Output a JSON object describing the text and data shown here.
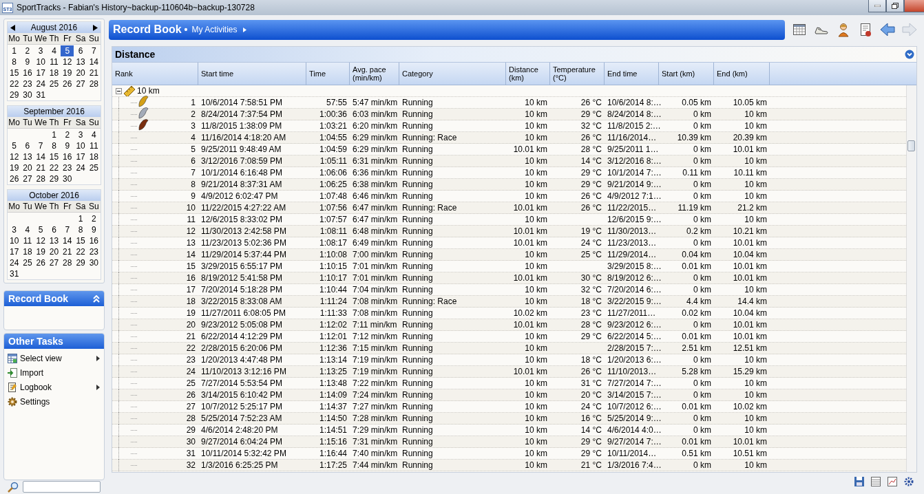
{
  "window": {
    "title": "SportTracks - Fabian's History~backup-110604b~backup-130728",
    "app_icon_text": "ST3"
  },
  "calendars": [
    {
      "title": "August 2016",
      "navigation": true,
      "weekdays": [
        "Mo",
        "Tu",
        "We",
        "Th",
        "Fr",
        "Sa",
        "Su"
      ],
      "weeks": [
        {
          "kind": "full",
          "days": [
            {
              "day": "1",
              "selected": false
            },
            {
              "day": "2",
              "selected": false
            },
            {
              "day": "3",
              "selected": false
            },
            {
              "day": "4",
              "selected": false
            },
            {
              "day": "5",
              "selected": true
            },
            {
              "day": "6",
              "selected": false
            },
            {
              "day": "7",
              "selected": false
            }
          ]
        },
        {
          "kind": "full",
          "days": [
            {
              "day": "8",
              "selected": false
            },
            {
              "day": "9",
              "selected": false
            },
            {
              "day": "10",
              "selected": false
            },
            {
              "day": "11",
              "selected": false
            },
            {
              "day": "12",
              "selected": false
            },
            {
              "day": "13",
              "selected": false
            },
            {
              "day": "14",
              "selected": false
            }
          ]
        },
        {
          "kind": "full",
          "days": [
            {
              "day": "15",
              "selected": false
            },
            {
              "day": "16",
              "selected": false
            },
            {
              "day": "17",
              "selected": false
            },
            {
              "day": "18",
              "selected": false
            },
            {
              "day": "19",
              "selected": false
            },
            {
              "day": "20",
              "selected": false
            },
            {
              "day": "21",
              "selected": false
            }
          ]
        },
        {
          "kind": "full",
          "days": [
            {
              "day": "22",
              "selected": false
            },
            {
              "day": "23",
              "selected": false
            },
            {
              "day": "24",
              "selected": false
            },
            {
              "day": "25",
              "selected": false
            },
            {
              "day": "26",
              "selected": false
            },
            {
              "day": "27",
              "selected": false
            },
            {
              "day": "28",
              "selected": false
            }
          ]
        },
        {
          "kind": "full",
          "days": [
            {
              "day": "29",
              "selected": false
            },
            {
              "day": "30",
              "selected": false
            },
            {
              "day": "31",
              "selected": false
            }
          ]
        }
      ]
    },
    {
      "title": "September 2016",
      "navigation": false,
      "weekdays": [
        "Mo",
        "Tu",
        "We",
        "Th",
        "Fr",
        "Sa",
        "Su"
      ],
      "weeks": [
        {
          "kind": "leading",
          "days": [
            {
              "day": "1",
              "selected": false
            },
            {
              "day": "2",
              "selected": false
            },
            {
              "day": "3",
              "selected": false
            },
            {
              "day": "4",
              "selected": false
            }
          ]
        },
        {
          "kind": "full",
          "days": [
            {
              "day": "5",
              "selected": false
            },
            {
              "day": "6",
              "selected": false
            },
            {
              "day": "7",
              "selected": false
            },
            {
              "day": "8",
              "selected": false
            },
            {
              "day": "9",
              "selected": false
            },
            {
              "day": "10",
              "selected": false
            },
            {
              "day": "11",
              "selected": false
            }
          ]
        },
        {
          "kind": "full",
          "days": [
            {
              "day": "12",
              "selected": false
            },
            {
              "day": "13",
              "selected": false
            },
            {
              "day": "14",
              "selected": false
            },
            {
              "day": "15",
              "selected": false
            },
            {
              "day": "16",
              "selected": false
            },
            {
              "day": "17",
              "selected": false
            },
            {
              "day": "18",
              "selected": false
            }
          ]
        },
        {
          "kind": "full",
          "days": [
            {
              "day": "19",
              "selected": false
            },
            {
              "day": "20",
              "selected": false
            },
            {
              "day": "21",
              "selected": false
            },
            {
              "day": "22",
              "selected": false
            },
            {
              "day": "23",
              "selected": false
            },
            {
              "day": "24",
              "selected": false
            },
            {
              "day": "25",
              "selected": false
            }
          ]
        },
        {
          "kind": "full",
          "days": [
            {
              "day": "26",
              "selected": false
            },
            {
              "day": "27",
              "selected": false
            },
            {
              "day": "28",
              "selected": false
            },
            {
              "day": "29",
              "selected": false
            },
            {
              "day": "30",
              "selected": false
            }
          ]
        }
      ]
    },
    {
      "title": "October 2016",
      "navigation": false,
      "weekdays": [
        "Mo",
        "Tu",
        "We",
        "Th",
        "Fr",
        "Sa",
        "Su"
      ],
      "weeks": [
        {
          "kind": "leading",
          "days": [
            {
              "day": "1",
              "selected": false
            },
            {
              "day": "2",
              "selected": false
            }
          ]
        },
        {
          "kind": "full",
          "days": [
            {
              "day": "3",
              "selected": false
            },
            {
              "day": "4",
              "selected": false
            },
            {
              "day": "5",
              "selected": false
            },
            {
              "day": "6",
              "selected": false
            },
            {
              "day": "7",
              "selected": false
            },
            {
              "day": "8",
              "selected": false
            },
            {
              "day": "9",
              "selected": false
            }
          ]
        },
        {
          "kind": "full",
          "days": [
            {
              "day": "10",
              "selected": false
            },
            {
              "day": "11",
              "selected": false
            },
            {
              "day": "12",
              "selected": false
            },
            {
              "day": "13",
              "selected": false
            },
            {
              "day": "14",
              "selected": false
            },
            {
              "day": "15",
              "selected": false
            },
            {
              "day": "16",
              "selected": false
            }
          ]
        },
        {
          "kind": "full",
          "days": [
            {
              "day": "17",
              "selected": false
            },
            {
              "day": "18",
              "selected": false
            },
            {
              "day": "19",
              "selected": false
            },
            {
              "day": "20",
              "selected": false
            },
            {
              "day": "21",
              "selected": false
            },
            {
              "day": "22",
              "selected": false
            },
            {
              "day": "23",
              "selected": false
            }
          ]
        },
        {
          "kind": "full",
          "days": [
            {
              "day": "24",
              "selected": false
            },
            {
              "day": "25",
              "selected": false
            },
            {
              "day": "26",
              "selected": false
            },
            {
              "day": "27",
              "selected": false
            },
            {
              "day": "28",
              "selected": false
            },
            {
              "day": "29",
              "selected": false
            },
            {
              "day": "30",
              "selected": false
            }
          ]
        },
        {
          "kind": "full",
          "days": [
            {
              "day": "31",
              "selected": false
            }
          ]
        }
      ]
    }
  ],
  "record_book_panel": {
    "title": "Record Book"
  },
  "other_tasks": {
    "title": "Other Tasks",
    "items": [
      {
        "label": "Select view",
        "kind": "view",
        "submenu": true
      },
      {
        "label": "Import",
        "kind": "import",
        "submenu": false
      },
      {
        "label": "Logbook",
        "kind": "logbook",
        "submenu": true
      },
      {
        "label": "Settings",
        "kind": "settings",
        "submenu": false
      }
    ]
  },
  "header": {
    "title": "Record Book",
    "separator": "•",
    "breadcrumb": "My Activities"
  },
  "section": {
    "title": "Distance"
  },
  "table": {
    "columns": [
      "Rank",
      "Start time",
      "Time",
      "Avg. pace (min/km)",
      "Category",
      "Distance (km)",
      "Temperature (°C)",
      "End time",
      "Start (km)",
      "End (km)"
    ],
    "group": {
      "label": "10 km",
      "expanded": true
    },
    "rows": [
      {
        "rank": "1",
        "kind": "gold",
        "start_time": "10/6/2014 7:58:51 PM",
        "time": "57:55",
        "pace": "5:47 min/km",
        "category": "Running",
        "distance": "10 km",
        "temperature": "26 °C",
        "end_time": "10/6/2014 8:…",
        "start_km": "0.05 km",
        "end_km": "10.05 km"
      },
      {
        "rank": "2",
        "kind": "silver",
        "start_time": "8/24/2014 7:37:54 PM",
        "time": "1:00:36",
        "pace": "6:03 min/km",
        "category": "Running",
        "distance": "10 km",
        "temperature": "29 °C",
        "end_time": "8/24/2014 8:…",
        "start_km": "0 km",
        "end_km": "10 km"
      },
      {
        "rank": "3",
        "kind": "bronze",
        "start_time": "11/8/2015 1:38:09 PM",
        "time": "1:03:21",
        "pace": "6:20 min/km",
        "category": "Running",
        "distance": "10 km",
        "temperature": "32 °C",
        "end_time": "11/8/2015 2:…",
        "start_km": "0 km",
        "end_km": "10 km"
      },
      {
        "rank": "4",
        "start_time": "11/16/2014 4:18:20 AM",
        "time": "1:04:55",
        "pace": "6:29 min/km",
        "category": "Running: Race",
        "distance": "10 km",
        "temperature": "26 °C",
        "end_time": "11/16/2014…",
        "start_km": "10.39 km",
        "end_km": "20.39 km"
      },
      {
        "rank": "5",
        "start_time": "9/25/2011 9:48:49 AM",
        "time": "1:04:59",
        "pace": "6:29 min/km",
        "category": "Running",
        "distance": "10.01 km",
        "temperature": "28 °C",
        "end_time": "9/25/2011 1…",
        "start_km": "0 km",
        "end_km": "10.01 km"
      },
      {
        "rank": "6",
        "start_time": "3/12/2016 7:08:59 PM",
        "time": "1:05:11",
        "pace": "6:31 min/km",
        "category": "Running",
        "distance": "10 km",
        "temperature": "14 °C",
        "end_time": "3/12/2016 8:…",
        "start_km": "0 km",
        "end_km": "10 km"
      },
      {
        "rank": "7",
        "start_time": "10/1/2014 6:16:48 PM",
        "time": "1:06:06",
        "pace": "6:36 min/km",
        "category": "Running",
        "distance": "10 km",
        "temperature": "29 °C",
        "end_time": "10/1/2014 7:…",
        "start_km": "0.11 km",
        "end_km": "10.11 km"
      },
      {
        "rank": "8",
        "start_time": "9/21/2014 8:37:31 AM",
        "time": "1:06:25",
        "pace": "6:38 min/km",
        "category": "Running",
        "distance": "10 km",
        "temperature": "29 °C",
        "end_time": "9/21/2014 9:…",
        "start_km": "0 km",
        "end_km": "10 km"
      },
      {
        "rank": "9",
        "start_time": "4/9/2012 6:02:47 PM",
        "time": "1:07:48",
        "pace": "6:46 min/km",
        "category": "Running",
        "distance": "10 km",
        "temperature": "26 °C",
        "end_time": "4/9/2012 7:1…",
        "start_km": "0 km",
        "end_km": "10 km"
      },
      {
        "rank": "10",
        "start_time": "11/22/2015 4:27:22 AM",
        "time": "1:07:56",
        "pace": "6:47 min/km",
        "category": "Running: Race",
        "distance": "10.01 km",
        "temperature": "26 °C",
        "end_time": "11/22/2015…",
        "start_km": "11.19 km",
        "end_km": "21.2 km"
      },
      {
        "rank": "11",
        "start_time": "12/6/2015 8:33:02 PM",
        "time": "1:07:57",
        "pace": "6:47 min/km",
        "category": "Running",
        "distance": "10 km",
        "end_time": "12/6/2015 9:…",
        "start_km": "0 km",
        "end_km": "10 km"
      },
      {
        "rank": "12",
        "start_time": "11/30/2013 2:42:58 PM",
        "time": "1:08:11",
        "pace": "6:48 min/km",
        "category": "Running",
        "distance": "10.01 km",
        "temperature": "19 °C",
        "end_time": "11/30/2013…",
        "start_km": "0.2 km",
        "end_km": "10.21 km"
      },
      {
        "rank": "13",
        "start_time": "11/23/2013 5:02:36 PM",
        "time": "1:08:17",
        "pace": "6:49 min/km",
        "category": "Running",
        "distance": "10.01 km",
        "temperature": "24 °C",
        "end_time": "11/23/2013…",
        "start_km": "0 km",
        "end_km": "10.01 km"
      },
      {
        "rank": "14",
        "start_time": "11/29/2014 5:37:44 PM",
        "time": "1:10:08",
        "pace": "7:00 min/km",
        "category": "Running",
        "distance": "10 km",
        "temperature": "25 °C",
        "end_time": "11/29/2014…",
        "start_km": "0.04 km",
        "end_km": "10.04 km"
      },
      {
        "rank": "15",
        "start_time": "3/29/2015 6:55:17 PM",
        "time": "1:10:15",
        "pace": "7:01 min/km",
        "category": "Running",
        "distance": "10 km",
        "end_time": "3/29/2015 8:…",
        "start_km": "0.01 km",
        "end_km": "10.01 km"
      },
      {
        "rank": "16",
        "start_time": "8/19/2012 5:41:58 PM",
        "time": "1:10:17",
        "pace": "7:01 min/km",
        "category": "Running",
        "distance": "10.01 km",
        "temperature": "30 °C",
        "end_time": "8/19/2012 6:…",
        "start_km": "0 km",
        "end_km": "10.01 km"
      },
      {
        "rank": "17",
        "start_time": "7/20/2014 5:18:28 PM",
        "time": "1:10:44",
        "pace": "7:04 min/km",
        "category": "Running",
        "distance": "10 km",
        "temperature": "32 °C",
        "end_time": "7/20/2014 6:…",
        "start_km": "0 km",
        "end_km": "10 km"
      },
      {
        "rank": "18",
        "start_time": "3/22/2015 8:33:08 AM",
        "time": "1:11:24",
        "pace": "7:08 min/km",
        "category": "Running: Race",
        "distance": "10 km",
        "temperature": "18 °C",
        "end_time": "3/22/2015 9:…",
        "start_km": "4.4 km",
        "end_km": "14.4 km"
      },
      {
        "rank": "19",
        "start_time": "11/27/2011 6:08:05 PM",
        "time": "1:11:33",
        "pace": "7:08 min/km",
        "category": "Running",
        "distance": "10.02 km",
        "temperature": "23 °C",
        "end_time": "11/27/2011…",
        "start_km": "0.02 km",
        "end_km": "10.04 km"
      },
      {
        "rank": "20",
        "start_time": "9/23/2012 5:05:08 PM",
        "time": "1:12:02",
        "pace": "7:11 min/km",
        "category": "Running",
        "distance": "10.01 km",
        "temperature": "28 °C",
        "end_time": "9/23/2012 6:…",
        "start_km": "0 km",
        "end_km": "10.01 km"
      },
      {
        "rank": "21",
        "start_time": "6/22/2014 4:12:29 PM",
        "time": "1:12:01",
        "pace": "7:12 min/km",
        "category": "Running",
        "distance": "10 km",
        "temperature": "29 °C",
        "end_time": "6/22/2014 5:…",
        "start_km": "0.01 km",
        "end_km": "10.01 km"
      },
      {
        "rank": "22",
        "start_time": "2/28/2015 6:20:06 PM",
        "time": "1:12:36",
        "pace": "7:15 min/km",
        "category": "Running",
        "distance": "10 km",
        "end_time": "2/28/2015 7:…",
        "start_km": "2.51 km",
        "end_km": "12.51 km"
      },
      {
        "rank": "23",
        "start_time": "1/20/2013 4:47:48 PM",
        "time": "1:13:14",
        "pace": "7:19 min/km",
        "category": "Running",
        "distance": "10 km",
        "temperature": "18 °C",
        "end_time": "1/20/2013 6:…",
        "start_km": "0 km",
        "end_km": "10 km"
      },
      {
        "rank": "24",
        "start_time": "11/10/2013 3:12:16 PM",
        "time": "1:13:25",
        "pace": "7:19 min/km",
        "category": "Running",
        "distance": "10.01 km",
        "temperature": "26 °C",
        "end_time": "11/10/2013…",
        "start_km": "5.28 km",
        "end_km": "15.29 km"
      },
      {
        "rank": "25",
        "start_time": "7/27/2014 5:53:54 PM",
        "time": "1:13:48",
        "pace": "7:22 min/km",
        "category": "Running",
        "distance": "10 km",
        "temperature": "31 °C",
        "end_time": "7/27/2014 7:…",
        "start_km": "0 km",
        "end_km": "10 km"
      },
      {
        "rank": "26",
        "start_time": "3/14/2015 6:10:42 PM",
        "time": "1:14:09",
        "pace": "7:24 min/km",
        "category": "Running",
        "distance": "10 km",
        "temperature": "20 °C",
        "end_time": "3/14/2015 7:…",
        "start_km": "0 km",
        "end_km": "10 km"
      },
      {
        "rank": "27",
        "start_time": "10/7/2012 5:25:17 PM",
        "time": "1:14:37",
        "pace": "7:27 min/km",
        "category": "Running",
        "distance": "10 km",
        "temperature": "24 °C",
        "end_time": "10/7/2012 6:…",
        "start_km": "0.01 km",
        "end_km": "10.02 km"
      },
      {
        "rank": "28",
        "start_time": "5/25/2014 7:52:23 AM",
        "time": "1:14:50",
        "pace": "7:28 min/km",
        "category": "Running",
        "distance": "10 km",
        "temperature": "16 °C",
        "end_time": "5/25/2014 9:…",
        "start_km": "0 km",
        "end_km": "10 km"
      },
      {
        "rank": "29",
        "start_time": "4/6/2014 2:48:20 PM",
        "time": "1:14:51",
        "pace": "7:29 min/km",
        "category": "Running",
        "distance": "10 km",
        "temperature": "14 °C",
        "end_time": "4/6/2014 4:0…",
        "start_km": "0 km",
        "end_km": "10 km"
      },
      {
        "rank": "30",
        "start_time": "9/27/2014 6:04:24 PM",
        "time": "1:15:16",
        "pace": "7:31 min/km",
        "category": "Running",
        "distance": "10 km",
        "temperature": "29 °C",
        "end_time": "9/27/2014 7:…",
        "start_km": "0.01 km",
        "end_km": "10.01 km"
      },
      {
        "rank": "31",
        "start_time": "10/11/2014 5:32:42 PM",
        "time": "1:16:44",
        "pace": "7:40 min/km",
        "category": "Running",
        "distance": "10 km",
        "temperature": "29 °C",
        "end_time": "10/11/2014…",
        "start_km": "0.51 km",
        "end_km": "10.51 km"
      },
      {
        "rank": "32",
        "start_time": "1/3/2016 6:25:25 PM",
        "time": "1:17:25",
        "pace": "7:44 min/km",
        "category": "Running",
        "distance": "10 km",
        "temperature": "21 °C",
        "end_time": "1/3/2016 7:4…",
        "start_km": "0 km",
        "end_km": "10 km"
      }
    ]
  }
}
